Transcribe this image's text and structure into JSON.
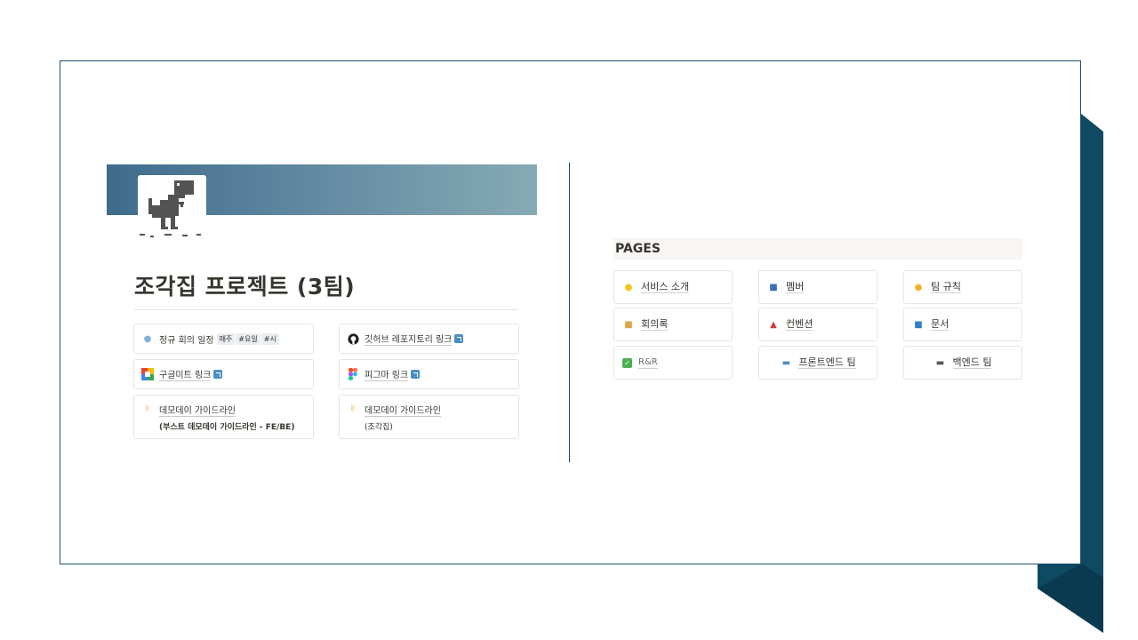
{
  "page": {
    "title": "조각집 프로젝트 (3팀)"
  },
  "left_callouts": [
    {
      "icon": "speech-bubble-icon",
      "label": "정규 회의 일정",
      "tags": [
        "매주",
        "#요일",
        "#시"
      ]
    },
    {
      "icon": "github-icon",
      "label": "깃허브 레포지토리 링크"
    },
    {
      "icon": "google-meet-icon",
      "label": "구글미트 링크"
    },
    {
      "icon": "figma-icon",
      "label": "피그마 링크"
    },
    {
      "icon": "waving-hand-icon",
      "label": "데모데이 가이드라인",
      "sub": "(부스트 데모데이 가이드라인 - FE/BE)"
    },
    {
      "icon": "waving-hand-icon",
      "label": "데모데이 가이드라인",
      "sub": "(조각집)"
    }
  ],
  "pages_section": {
    "heading": "PAGES",
    "items": [
      {
        "icon": "lightbulb-icon",
        "label": "서비스 소개"
      },
      {
        "icon": "members-icon",
        "label": "멤버"
      },
      {
        "icon": "handshake-icon",
        "label": "팀 규칙"
      },
      {
        "icon": "scroll-icon",
        "label": "회의록"
      },
      {
        "icon": "pushpin-icon",
        "label": "컨벤션"
      },
      {
        "icon": "folder-icon",
        "label": "문서"
      },
      {
        "icon": "checkbox-icon",
        "label": "R&R"
      },
      {
        "icon": "monitor-icon",
        "label": "프론트엔드 팀"
      },
      {
        "icon": "keyboard-icon",
        "label": "백엔드 팀"
      }
    ]
  },
  "colors": {
    "accent": "#1f4e6b",
    "deco": "#0f4a63",
    "cover_start": "#3f6b8c",
    "cover_end": "#86aab5"
  }
}
